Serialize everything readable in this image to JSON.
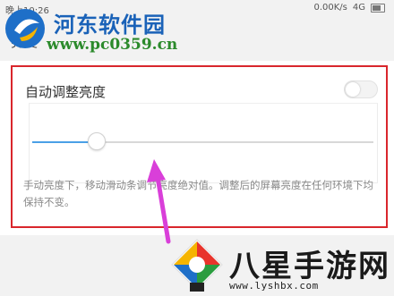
{
  "status_bar": {
    "time": "晚上10:26",
    "network_speed": "0.00K/s",
    "network_type": "4G"
  },
  "page": {
    "title": "亮度"
  },
  "setting": {
    "auto_brightness_label": "自动调整亮度",
    "auto_brightness_enabled": false,
    "brightness_level_fraction": 0.19,
    "description": "手动亮度下，移动滑动条调节亮度绝对值。调整后的屏幕亮度在任何环境下均保持不变。"
  },
  "annotation": {
    "frame_color": "#d9262c",
    "arrow_color": "#d93fd9"
  },
  "watermarks": {
    "top_name": "河东软件园",
    "top_url": "www.pc0359.cn",
    "bottom_name": "八星手游网",
    "bottom_url": "www.lyshbx.com"
  },
  "colors": {
    "slider_fill": "#4aa0e6",
    "card_bg": "#ffffff",
    "page_bg": "#f2f2f2"
  }
}
